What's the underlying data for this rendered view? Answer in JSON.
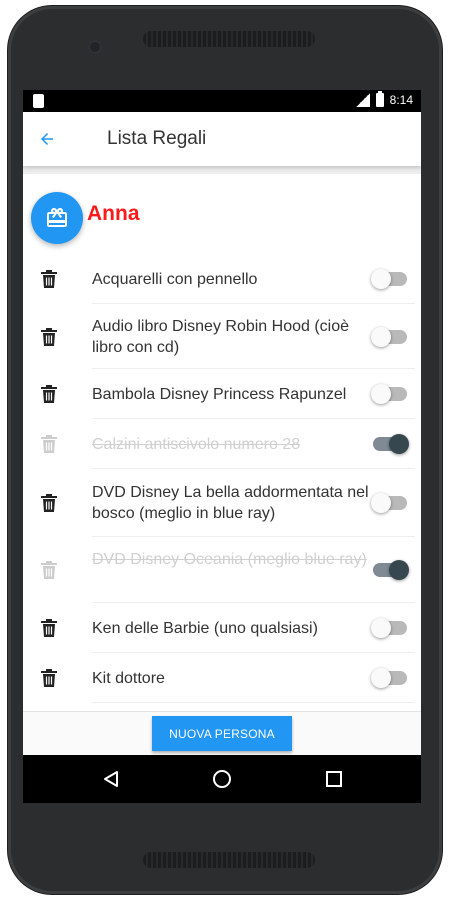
{
  "status_bar": {
    "time": "8:14"
  },
  "app_bar": {
    "title": "Lista Regali",
    "accent": "#2196f3"
  },
  "person": {
    "name": "Anna",
    "name_color": "#ff1a1a"
  },
  "gifts": [
    {
      "label": "Acquarelli con pennello",
      "done": false
    },
    {
      "label": "Audio libro Disney Robin Hood (cioè libro con cd)",
      "done": false
    },
    {
      "label": "Bambola Disney Princess Rapunzel",
      "done": false
    },
    {
      "label": "Calzini antiscivolo numero 28",
      "done": true
    },
    {
      "label": "DVD Disney La bella addormentata nel bosco (meglio in blue ray)",
      "done": false
    },
    {
      "label": "DVD Disney Oceania (meglio blue ray)",
      "done": true
    },
    {
      "label": "Ken delle Barbie (uno qualsiasi)",
      "done": false
    },
    {
      "label": "Kit dottore",
      "done": false
    }
  ],
  "footer": {
    "new_person_label": "NUOVA PERSONA"
  },
  "icons": {
    "back": "arrow-back-icon",
    "avatar": "gift-icon",
    "delete": "trash-icon",
    "nav": [
      "back-triangle-icon",
      "home-circle-icon",
      "recents-square-icon"
    ]
  }
}
